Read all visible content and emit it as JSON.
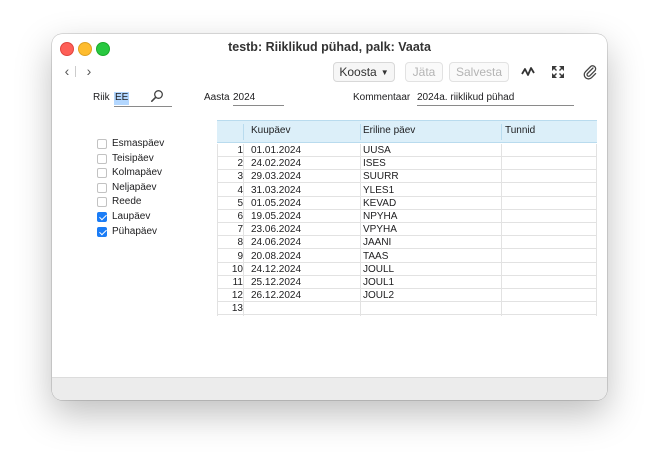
{
  "window": {
    "title": "testb: Riiklikud pühad, palk: Vaata"
  },
  "toolbar": {
    "koosta_label": "Koosta",
    "jata_label": "Jäta",
    "salvesta_label": "Salvesta"
  },
  "form": {
    "riik_label": "Riik",
    "riik_value": "EE",
    "aasta_label": "Aasta",
    "aasta_value": "2024",
    "kommentaar_label": "Kommentaar",
    "kommentaar_value": "2024a. riiklikud pühad"
  },
  "weekdays": [
    {
      "label": "Esmaspäev",
      "checked": false
    },
    {
      "label": "Teisipäev",
      "checked": false
    },
    {
      "label": "Kolmapäev",
      "checked": false
    },
    {
      "label": "Neljapäev",
      "checked": false
    },
    {
      "label": "Reede",
      "checked": false
    },
    {
      "label": "Laupäev",
      "checked": true
    },
    {
      "label": "Pühapäev",
      "checked": true
    }
  ],
  "grid": {
    "headers": [
      "Kuupäev",
      "Eriline päev",
      "Tunnid"
    ],
    "rows": [
      {
        "num": "1",
        "date": "01.01.2024",
        "code": "UUSA",
        "hours": ""
      },
      {
        "num": "2",
        "date": "24.02.2024",
        "code": "ISES",
        "hours": ""
      },
      {
        "num": "3",
        "date": "29.03.2024",
        "code": "SUURR",
        "hours": ""
      },
      {
        "num": "4",
        "date": "31.03.2024",
        "code": "YLES1",
        "hours": ""
      },
      {
        "num": "5",
        "date": "01.05.2024",
        "code": "KEVAD",
        "hours": ""
      },
      {
        "num": "6",
        "date": "19.05.2024",
        "code": "NPYHA",
        "hours": ""
      },
      {
        "num": "7",
        "date": "23.06.2024",
        "code": "VPYHA",
        "hours": ""
      },
      {
        "num": "8",
        "date": "24.06.2024",
        "code": "JAANI",
        "hours": ""
      },
      {
        "num": "9",
        "date": "20.08.2024",
        "code": "TAAS",
        "hours": ""
      },
      {
        "num": "10",
        "date": "24.12.2024",
        "code": "JOULL",
        "hours": ""
      },
      {
        "num": "11",
        "date": "25.12.2024",
        "code": "JOUL1",
        "hours": ""
      },
      {
        "num": "12",
        "date": "26.12.2024",
        "code": "JOUL2",
        "hours": ""
      },
      {
        "num": "13",
        "date": "",
        "code": "",
        "hours": ""
      }
    ]
  },
  "colors": {
    "accent": "#1a7cf6",
    "header_bg": "#dceff9"
  },
  "icons": [
    "back-icon",
    "forward-icon",
    "chevron-down-icon",
    "activity-icon",
    "expand-icon",
    "paperclip-icon",
    "search-icon"
  ]
}
